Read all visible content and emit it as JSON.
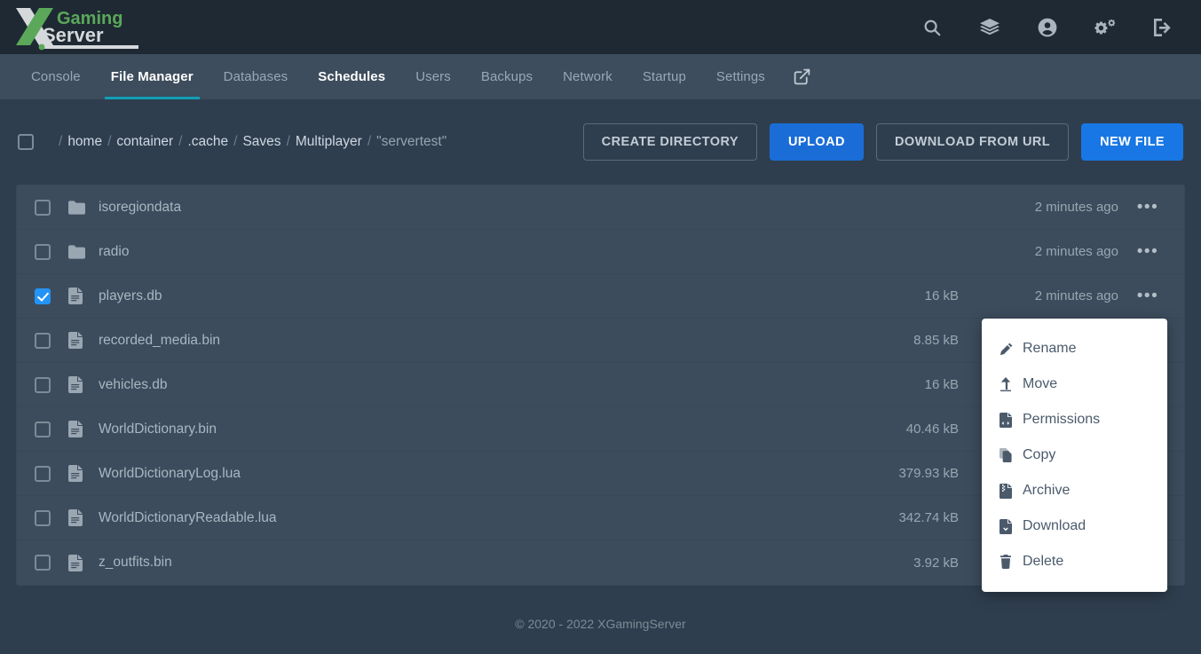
{
  "brand": {
    "name_top": "Gaming",
    "name_bottom": "Server",
    "mark": "X",
    "accent": "#5ba85a",
    "light": "#d5d9dc"
  },
  "header": {
    "icons": [
      {
        "name": "search-icon",
        "label": "Search"
      },
      {
        "name": "layers-icon",
        "label": "Servers"
      },
      {
        "name": "account-icon",
        "label": "Account"
      },
      {
        "name": "admin-gears-icon",
        "label": "Admin"
      },
      {
        "name": "logout-icon",
        "label": "Sign Out"
      }
    ]
  },
  "nav": {
    "tabs": [
      {
        "label": "Console",
        "state": "normal"
      },
      {
        "label": "File Manager",
        "state": "active"
      },
      {
        "label": "Databases",
        "state": "normal"
      },
      {
        "label": "Schedules",
        "state": "bright"
      },
      {
        "label": "Users",
        "state": "normal"
      },
      {
        "label": "Backups",
        "state": "normal"
      },
      {
        "label": "Network",
        "state": "normal"
      },
      {
        "label": "Startup",
        "state": "normal"
      },
      {
        "label": "Settings",
        "state": "normal"
      }
    ],
    "external_link_label": "Open in new window",
    "active_underline_color": "#119eb8"
  },
  "breadcrumb": {
    "select_all_checked": false,
    "root": "/",
    "segments": [
      {
        "label": "home",
        "current": false
      },
      {
        "label": "container",
        "current": false
      },
      {
        "label": ".cache",
        "current": false
      },
      {
        "label": "Saves",
        "current": false
      },
      {
        "label": "Multiplayer",
        "current": false
      },
      {
        "label": "\"servertest\"",
        "current": true
      }
    ]
  },
  "toolbar": {
    "create_directory_label": "CREATE DIRECTORY",
    "upload_label": "UPLOAD",
    "download_from_url_label": "DOWNLOAD FROM URL",
    "new_file_label": "NEW FILE",
    "primary_color": "#1a6dd6"
  },
  "files": [
    {
      "name": "isoregiondata",
      "type": "folder",
      "size": "",
      "modified": "2 minutes ago",
      "selected": false
    },
    {
      "name": "radio",
      "type": "folder",
      "size": "",
      "modified": "2 minutes ago",
      "selected": false
    },
    {
      "name": "players.db",
      "type": "file",
      "size": "16 kB",
      "modified": "2 minutes ago",
      "selected": true
    },
    {
      "name": "recorded_media.bin",
      "type": "file",
      "size": "8.85 kB",
      "modified": "",
      "selected": false
    },
    {
      "name": "vehicles.db",
      "type": "file",
      "size": "16 kB",
      "modified": "",
      "selected": false
    },
    {
      "name": "WorldDictionary.bin",
      "type": "file",
      "size": "40.46 kB",
      "modified": "",
      "selected": false
    },
    {
      "name": "WorldDictionaryLog.lua",
      "type": "file",
      "size": "379.93 kB",
      "modified": "",
      "selected": false
    },
    {
      "name": "WorldDictionaryReadable.lua",
      "type": "file",
      "size": "342.74 kB",
      "modified": "",
      "selected": false
    },
    {
      "name": "z_outfits.bin",
      "type": "file",
      "size": "3.92 kB",
      "modified": "",
      "selected": false
    }
  ],
  "context_menu": {
    "items": [
      {
        "label": "Rename",
        "icon": "pencil-icon"
      },
      {
        "label": "Move",
        "icon": "arrow-up-icon"
      },
      {
        "label": "Permissions",
        "icon": "file-code-icon"
      },
      {
        "label": "Copy",
        "icon": "copy-icon"
      },
      {
        "label": "Archive",
        "icon": "file-archive-icon"
      },
      {
        "label": "Download",
        "icon": "file-download-icon"
      },
      {
        "label": "Delete",
        "icon": "trash-icon"
      }
    ]
  },
  "footer": {
    "copyright": "© 2020 - 2022 XGamingServer"
  }
}
